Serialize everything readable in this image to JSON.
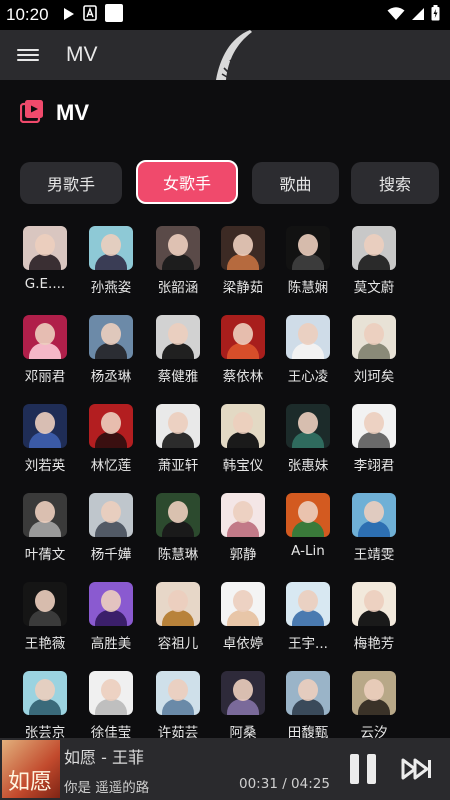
{
  "status_bar": {
    "time": "10:20"
  },
  "app_bar": {
    "title": "MV"
  },
  "section": {
    "title": "MV",
    "accent": "#f04a6c"
  },
  "tabs": [
    {
      "label": "男歌手",
      "active": false
    },
    {
      "label": "女歌手",
      "active": true
    },
    {
      "label": "歌曲",
      "active": false
    },
    {
      "label": "搜索",
      "active": false
    }
  ],
  "artists": [
    "G.E....",
    "孙燕姿",
    "张韶涵",
    "梁静茹",
    "陈慧娴",
    "莫文蔚",
    "邓丽君",
    "杨丞琳",
    "蔡健雅",
    "蔡依林",
    "王心凌",
    "刘珂矣",
    "刘若英",
    "林忆莲",
    "萧亚轩",
    "韩宝仪",
    "张惠妹",
    "李翊君",
    "叶蒨文",
    "杨千嬅",
    "陈慧琳",
    "郭静",
    "A-Lin",
    "王靖雯",
    "王艳薇",
    "高胜美",
    "容祖儿",
    "卓依婷",
    "王宇...",
    "梅艳芳",
    "张芸京",
    "徐佳莹",
    "许茹芸",
    "阿桑",
    "田馥甄",
    "云汐"
  ],
  "player": {
    "title": "如愿 - 王菲",
    "lyric": "你是 遥遥的路",
    "time": "00:31 / 04:25",
    "cover_text": "如愿"
  }
}
